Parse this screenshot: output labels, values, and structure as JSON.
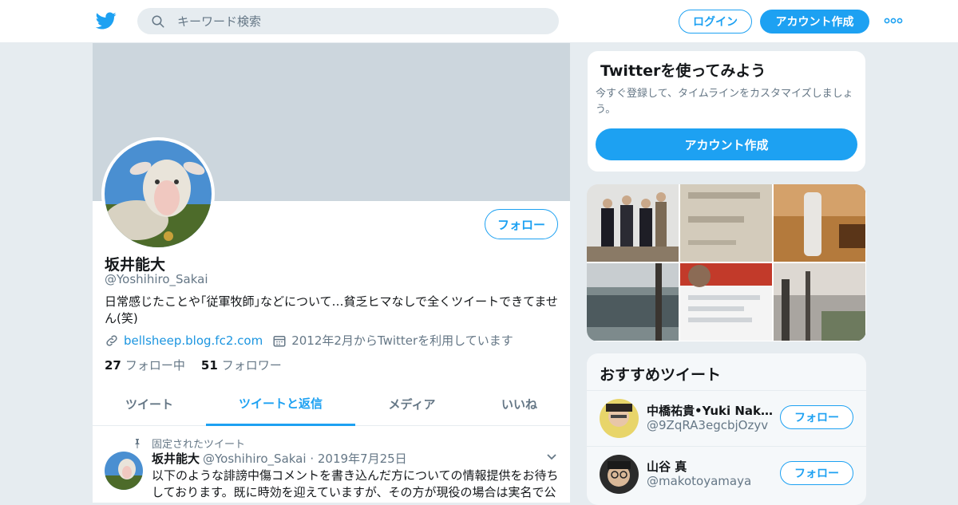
{
  "header": {
    "search_placeholder": "キーワード検索",
    "login_label": "ログイン",
    "signup_label": "アカウント作成"
  },
  "profile": {
    "name": "坂井能大",
    "handle": "@Yoshihiro_Sakai",
    "follow_label": "フォロー",
    "bio": "日常感じたことや｢従軍牧師｣などについて…貧乏ヒマなしで全くツイートできてません(笑)",
    "website": "bellsheep.blog.fc2.com",
    "joined": "2012年2月からTwitterを利用しています",
    "following_count": "27",
    "following_label": "フォロー中",
    "followers_count": "51",
    "followers_label": "フォロワー"
  },
  "tabs": [
    {
      "label": "ツイート"
    },
    {
      "label": "ツイートと返信"
    },
    {
      "label": "メディア"
    },
    {
      "label": "いいね"
    }
  ],
  "active_tab": "ツイートと返信",
  "tweet": {
    "pinned_label": "固定されたツイート",
    "author": "坂井能大",
    "handle": "@Yoshihiro_Sakai",
    "date": "2019年7月25日",
    "text": "以下のような誹謗中傷コメントを書き込んだ方についての情報提供をお待ちしております。既に時効を迎えていますが、その方が現役の場合は実名で公開します。"
  },
  "promo": {
    "title": "Twitterを使ってみよう",
    "text": "今すぐ登録して、タイムラインをカスタマイズしましょう。",
    "button_label": "アカウント作成"
  },
  "recommendations": {
    "title": "おすすめツイート",
    "items": [
      {
        "name": "中橋祐貴•Yuki Nakahashi",
        "handle": "@9ZqRA3egcbjOzyv",
        "follow_label": "フォロー"
      },
      {
        "name": "山谷 真",
        "handle": "@makotoyamaya",
        "follow_label": "フォロー"
      }
    ]
  },
  "colors": {
    "accent": "#1da1f2",
    "banner": "#ccd6dd",
    "muted_text": "#657786",
    "page_bg": "#e6ecf0"
  },
  "icons": [
    "twitter-bird-icon",
    "search-icon",
    "more-icon",
    "link-icon",
    "calendar-icon",
    "pin-icon",
    "chevron-down-icon"
  ]
}
